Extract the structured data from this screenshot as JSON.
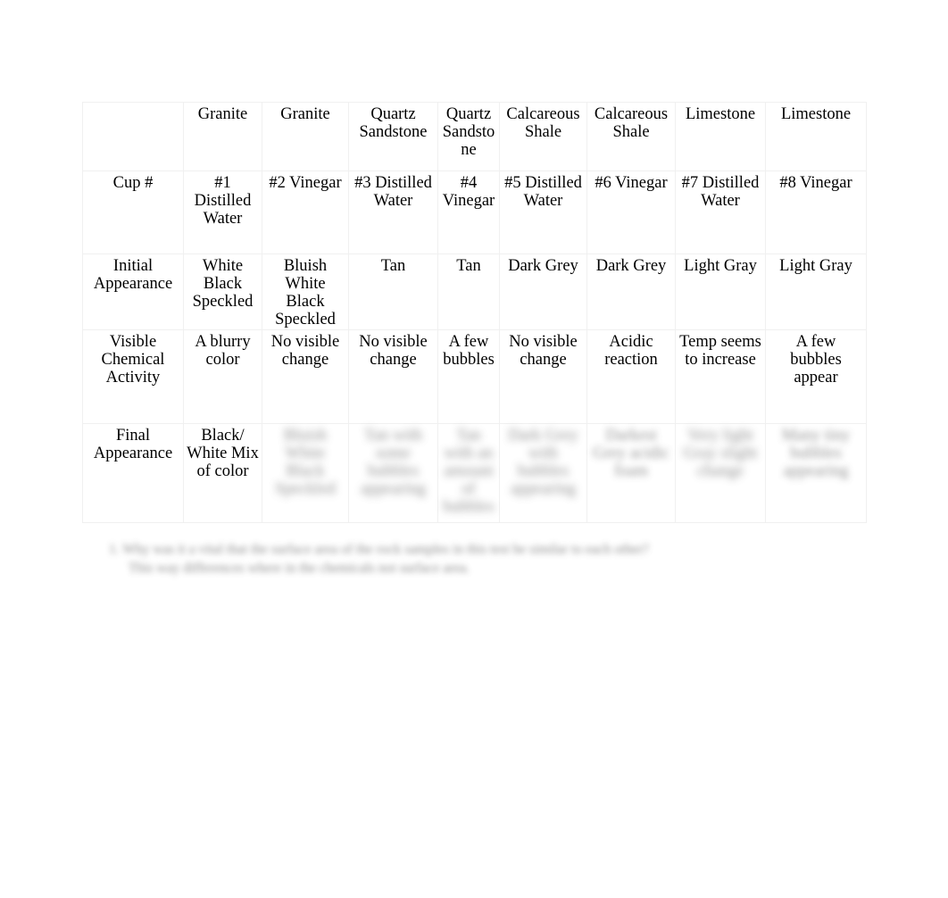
{
  "table": {
    "columns": [
      {
        "key": "label",
        "rock": ""
      },
      {
        "key": "c1",
        "rock": "Granite"
      },
      {
        "key": "c2",
        "rock": "Granite"
      },
      {
        "key": "c3",
        "rock": "Quartz Sandstone"
      },
      {
        "key": "c4",
        "rock": "Quartz Sandstone"
      },
      {
        "key": "c5",
        "rock": "Calcareous Shale"
      },
      {
        "key": "c6",
        "rock": "Calcareous Shale"
      },
      {
        "key": "c7",
        "rock": "Limestone"
      },
      {
        "key": "c8",
        "rock": "Limestone"
      }
    ],
    "rows": {
      "header": {
        "label": "",
        "cells": [
          "Granite",
          "Granite",
          "Quartz Sandstone",
          "Quartz Sandstone",
          "Calcareous Shale",
          "Calcareous Shale",
          "Limestone",
          "Limestone"
        ]
      },
      "cup": {
        "label": "Cup #",
        "cells": [
          "#1 Distilled Water",
          "#2 Vinegar",
          "#3 Distilled Water",
          "#4 Vinegar",
          "#5 Distilled Water",
          "#6 Vinegar",
          "#7 Distilled Water",
          "#8 Vinegar"
        ]
      },
      "initial": {
        "label": "Initial Appearance",
        "cells": [
          "White Black Speckled",
          "Bluish White Black Speckled",
          "Tan",
          "Tan",
          "Dark Grey",
          "Dark Grey",
          "Light Gray",
          "Light Gray"
        ]
      },
      "visible": {
        "label": "Visible Chemical Activity",
        "cells": [
          "A blurry color",
          "No visible change",
          "No visible change",
          "A few bubbles",
          "No visible change",
          "Acidic reaction",
          "Temp seems to increase",
          "A few bubbles appear"
        ]
      },
      "final": {
        "label": "Final Appearance",
        "cells": [
          "Black/ White Mix of color",
          "Bluish White Black Speckled",
          "Tan with some bubbles appearing",
          "Tan with an amount of bubbles",
          "Dark Grey with bubbles appearing",
          "Darkest Grey acidic foam",
          "Very light Gray slight change",
          "Many tiny bubbles appearing"
        ]
      }
    }
  },
  "footnote": {
    "line1": "1.  Why was it a vital that the surface area of the rock samples in this test be similar to each other?",
    "line2": "This way differences where in the chemicals not surface area."
  }
}
